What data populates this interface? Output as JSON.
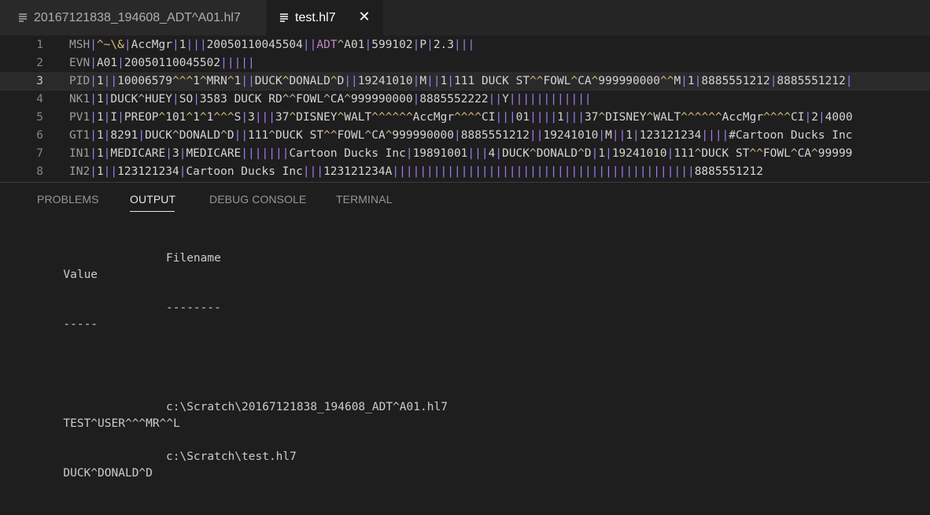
{
  "tabs": [
    {
      "label": "20167121838_194608_ADT^A01.hl7",
      "active": false
    },
    {
      "label": "test.hl7",
      "active": true,
      "close_glyph": "✕"
    }
  ],
  "editor": {
    "lines": [
      {
        "number": "1",
        "text": "MSH|^~\\&|AccMgr|1|||20050110045504||ADT^A01|599102|P|2.3|||"
      },
      {
        "number": "2",
        "text": "EVN|A01|20050110045502|||||"
      },
      {
        "number": "3",
        "text": "PID|1||10006579^^^1^MRN^1||DUCK^DONALD^D||19241010|M||1|111 DUCK ST^^FOWL^CA^999990000^^M|1|8885551212|8885551212|"
      },
      {
        "number": "4",
        "text": "NK1|1|DUCK^HUEY|SO|3583 DUCK RD^^FOWL^CA^999990000|8885552222||Y||||||||||||"
      },
      {
        "number": "5",
        "text": "PV1|1|I|PREOP^101^1^1^^^S|3|||37^DISNEY^WALT^^^^^^AccMgr^^^^CI|||01||||1|||37^DISNEY^WALT^^^^^^AccMgr^^^^CI|2|4000"
      },
      {
        "number": "6",
        "text": "GT1|1|8291|DUCK^DONALD^D||111^DUCK ST^^FOWL^CA^999990000|8885551212||19241010|M||1|123121234||||#Cartoon Ducks Inc"
      },
      {
        "number": "7",
        "text": "IN1|1|MEDICARE|3|MEDICARE|||||||Cartoon Ducks Inc|19891001|||4|DUCK^DONALD^D|1|19241010|111^DUCK ST^^FOWL^CA^99999"
      },
      {
        "number": "8",
        "text": "IN2|1||123121234|Cartoon Ducks Inc|||123121234A||||||||||||||||||||||||||||||||||||||||||||8885551212"
      }
    ],
    "current_line": 3
  },
  "panel": {
    "tabs": [
      "PROBLEMS",
      "OUTPUT",
      "DEBUG CONSOLE",
      "TERMINAL"
    ],
    "active_tab": "OUTPUT",
    "output": {
      "headers": [
        "Value",
        "Filename"
      ],
      "separators": [
        "-----",
        "--------"
      ],
      "rows": [
        [
          "TEST^USER^^^MR^^L",
          "c:\\Scratch\\20167121838_194608_ADT^A01.hl7"
        ],
        [
          "DUCK^DONALD^D",
          "c:\\Scratch\\test.hl7"
        ]
      ]
    }
  },
  "colors": {
    "editor_bg": "#1e1e1e",
    "tab_bar_bg": "#252526",
    "segment": "#9e9e9e",
    "field_delim": "#a07cf0",
    "component_delim": "#d7ba7d",
    "keyword": "#c586c0"
  },
  "icons": {
    "tab_file": "file-lines-icon",
    "tab_close": "close-icon"
  }
}
